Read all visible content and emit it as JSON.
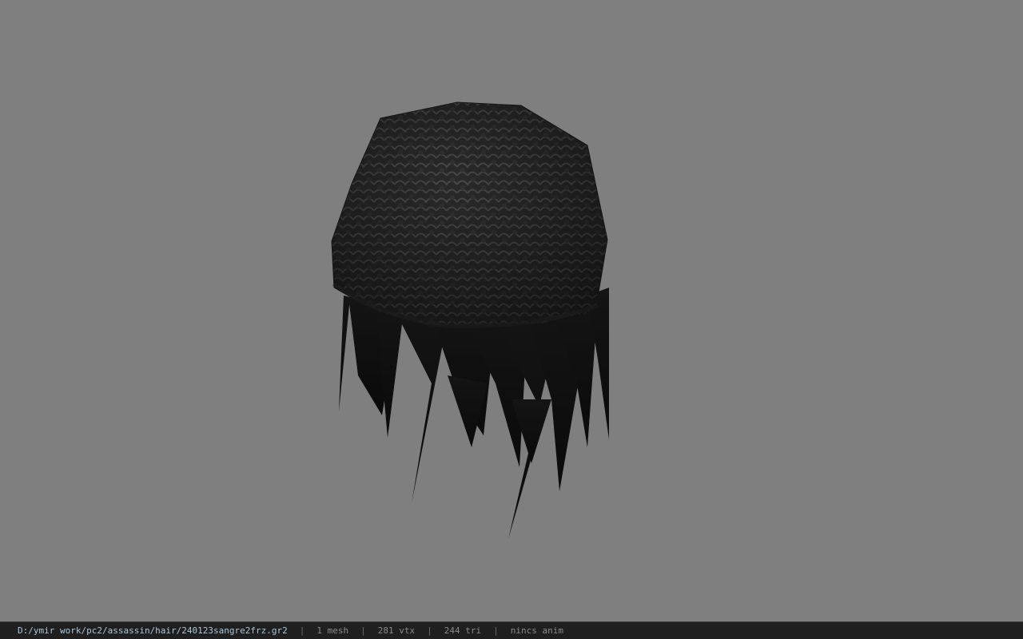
{
  "viewer": {
    "background": "#7f7f7f",
    "model_icon": "hair-mesh-icon"
  },
  "status": {
    "file_path": "D:/ymir work/pc2/assassin/hair/240123sangre2frz.gr2",
    "mesh_count": "1 mesh",
    "vertex_count": "281 vtx",
    "triangle_count": "244 tri",
    "anim_state": "nincs anim",
    "separator": "|"
  }
}
